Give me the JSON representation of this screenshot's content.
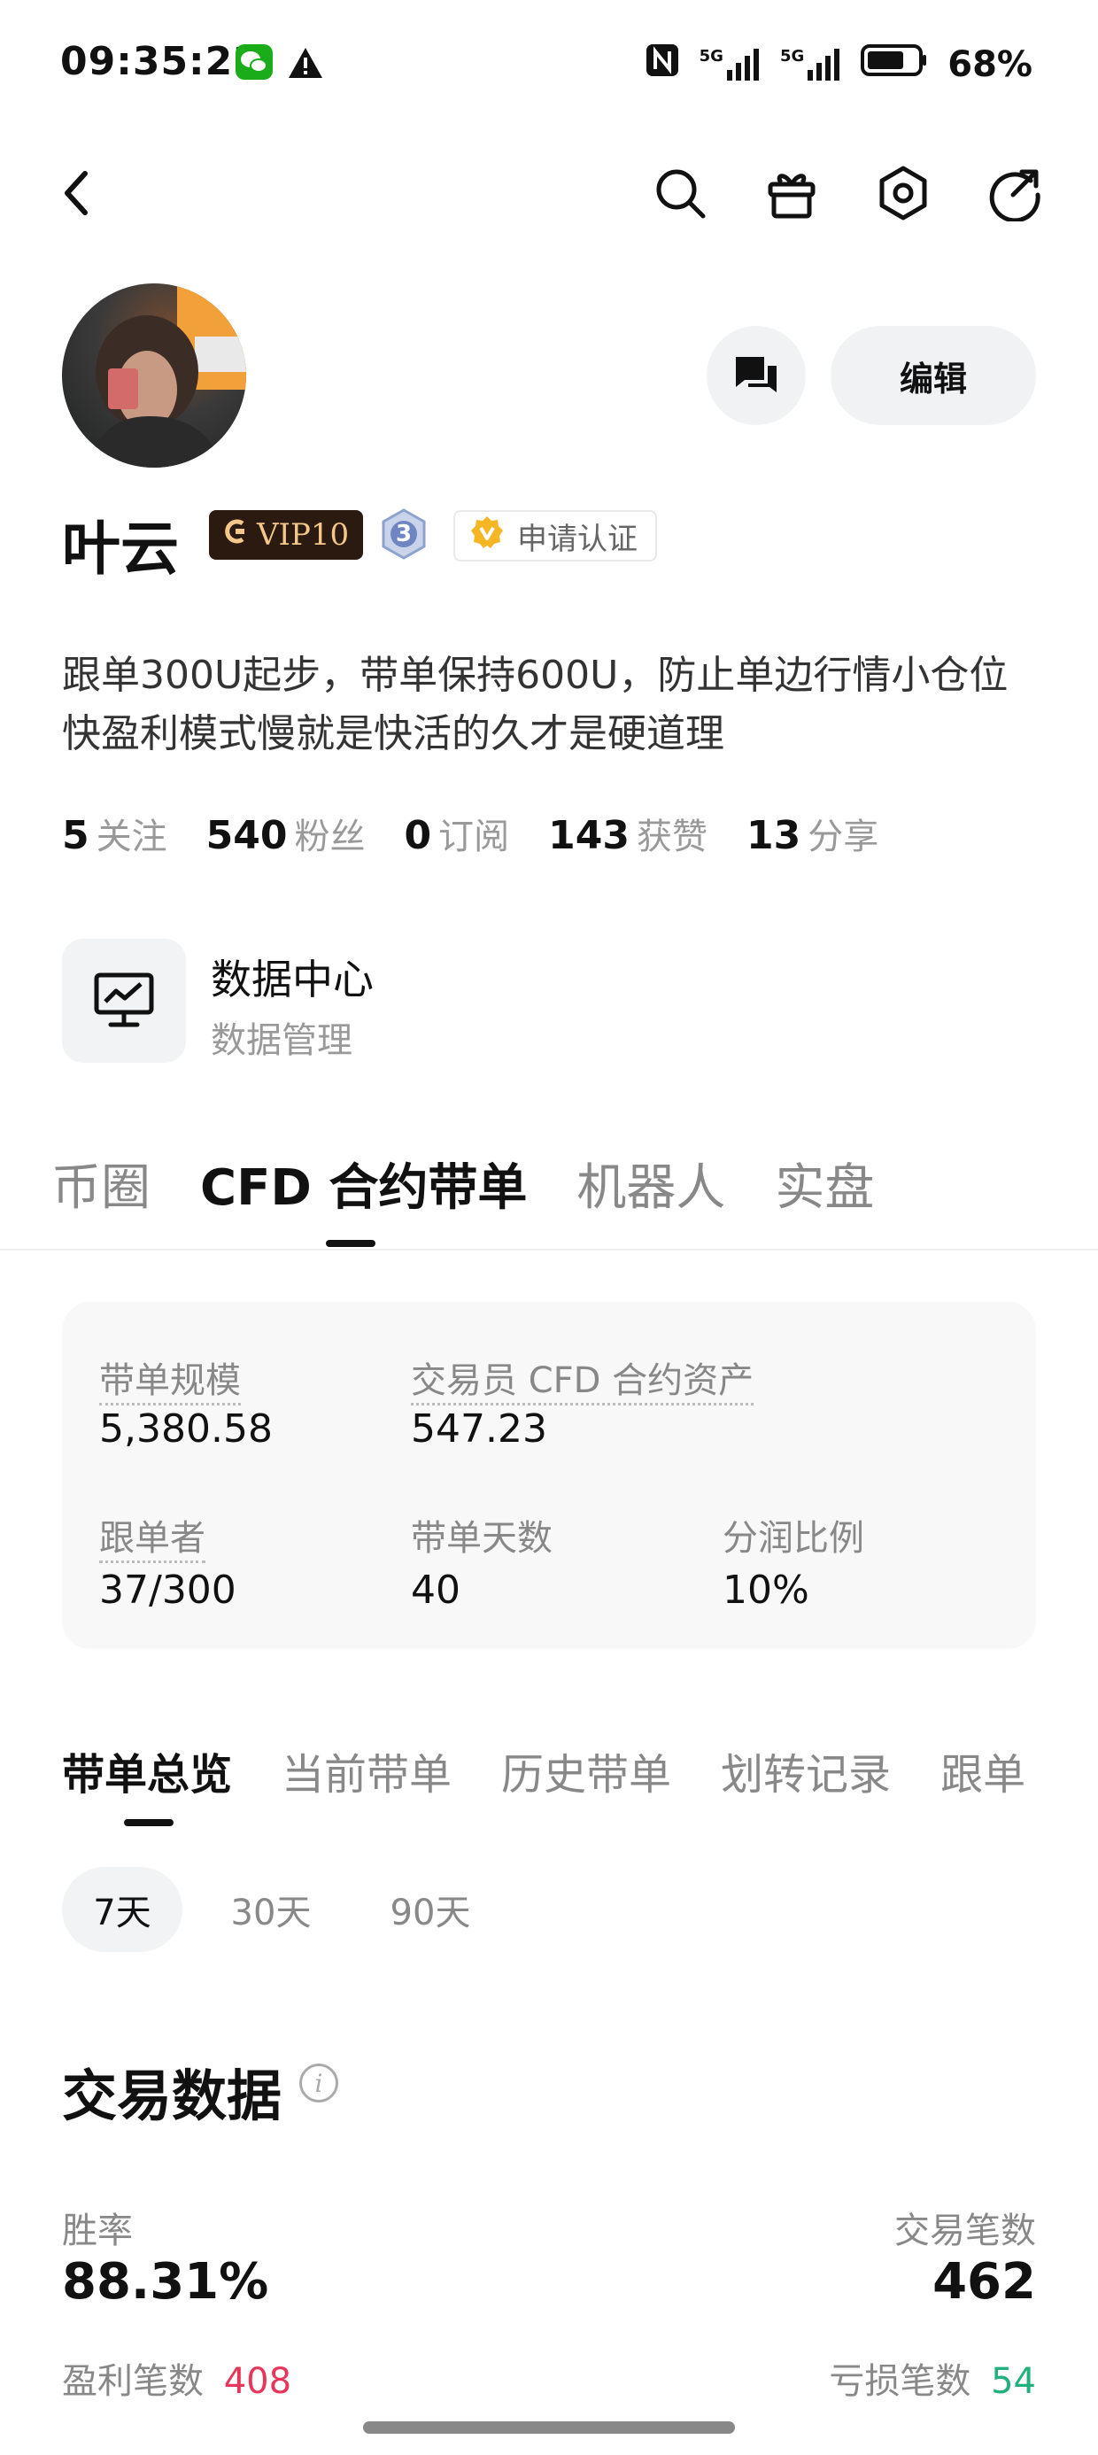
{
  "status_bar": {
    "time": "09:35:22",
    "battery": "68%",
    "net1": "5G",
    "net2": "5G"
  },
  "profile": {
    "name": "叶云",
    "vip_label": "VIP10",
    "level": "3",
    "cert_label": "申请认证",
    "edit_label": "编辑",
    "bio": "跟单300U起步，带单保持600U，防止单边行情小仓位快盈利模式慢就是快活的久才是硬道理",
    "stats": [
      {
        "num": "5",
        "label": "关注"
      },
      {
        "num": "540",
        "label": "粉丝"
      },
      {
        "num": "0",
        "label": "订阅"
      },
      {
        "num": "143",
        "label": "获赞"
      },
      {
        "num": "13",
        "label": "分享"
      }
    ]
  },
  "data_center": {
    "title": "数据中心",
    "subtitle": "数据管理"
  },
  "main_tabs": [
    "币圈",
    "CFD 合约带单",
    "机器人",
    "实盘"
  ],
  "summary_card": {
    "scale_label": "带单规模",
    "scale_value": "5,380.58",
    "assets_label": "交易员 CFD 合约资产",
    "assets_value": "547.23",
    "followers_label": "跟单者",
    "followers_value": "37/300",
    "days_label": "带单天数",
    "days_value": "40",
    "share_label": "分润比例",
    "share_value": "10%"
  },
  "sub_tabs": [
    "带单总览",
    "当前带单",
    "历史带单",
    "划转记录",
    "跟单"
  ],
  "periods": [
    "7天",
    "30天",
    "90天"
  ],
  "trade_data": {
    "title": "交易数据",
    "win_rate_label": "胜率",
    "win_rate_value": "88.31%",
    "trades_label": "交易笔数",
    "trades_value": "462",
    "profit_label": "盈利笔数",
    "profit_value": "408",
    "loss_label": "亏损笔数",
    "loss_value": "54"
  },
  "colors": {
    "profit": "#e8365b",
    "loss": "#22b07d",
    "vip_gold": "#f4c78a",
    "cert_gold": "#f5b623"
  }
}
